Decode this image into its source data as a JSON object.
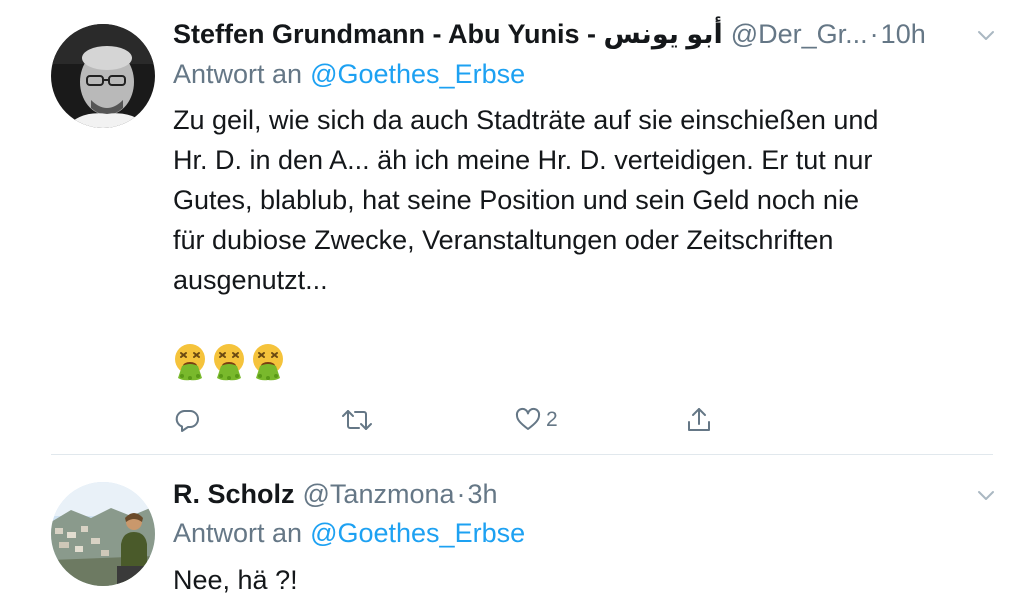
{
  "colors": {
    "text": "#14171a",
    "secondary": "#657786",
    "link": "#1da1f2",
    "divider": "#e1e8ed"
  },
  "tweets": [
    {
      "display_name": "Steffen Grundmann - Abu Yunis - أبو يونس",
      "handle": "@Der_Gr...",
      "separator": "·",
      "time": "10h",
      "reply_prefix": "Antwort an",
      "reply_to": "@Goethes_Erbse",
      "text_lines": [
        "Zu geil, wie sich da auch Stadträte auf sie einschießen und",
        "Hr. D. in den A... äh ich meine Hr. D. verteidigen. Er tut nur",
        "Gutes, blablub, hat seine Position und sein Geld noch nie",
        "für dubiose Zwecke, Veranstaltungen oder Zeitschriften",
        "ausgenutzt..."
      ],
      "emojis": [
        "vomiting-face",
        "vomiting-face",
        "vomiting-face"
      ],
      "actions": {
        "reply_icon": "reply-icon",
        "retweet_icon": "retweet-icon",
        "like_icon": "heart-icon",
        "like_count": "2",
        "share_icon": "share-icon"
      }
    },
    {
      "display_name": "R. Scholz",
      "handle": "@Tanzmona",
      "separator": "·",
      "time": "3h",
      "reply_prefix": "Antwort an",
      "reply_to": "@Goethes_Erbse",
      "text_lines": [
        "Nee, hä ?!"
      ]
    }
  ]
}
